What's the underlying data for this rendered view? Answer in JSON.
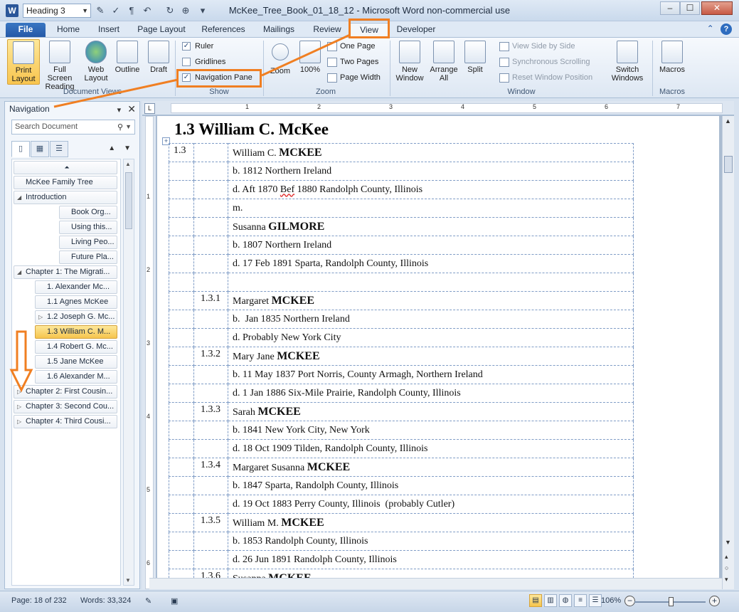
{
  "window": {
    "title": "McKee_Tree_Book_01_18_12 - Microsoft Word non-commercial use",
    "style_box": "Heading 3",
    "word_logo": "W",
    "controls": [
      "–",
      "☐",
      "✕"
    ]
  },
  "ribbon_tabs": [
    "File",
    "Home",
    "Insert",
    "Page Layout",
    "References",
    "Mailings",
    "Review",
    "View",
    "Developer"
  ],
  "ribbon": {
    "document_views": {
      "label": "Document Views",
      "buttons": [
        "Print Layout",
        "Full Screen Reading",
        "Web Layout",
        "Outline",
        "Draft"
      ]
    },
    "show": {
      "label": "Show",
      "ruler": "Ruler",
      "gridlines": "Gridlines",
      "navigation_pane": "Navigation Pane",
      "ruler_checked": true,
      "gridlines_checked": false,
      "navigation_pane_checked": true
    },
    "zoom": {
      "label": "Zoom",
      "zoom": "Zoom",
      "hundred": "100%",
      "one_page": "One Page",
      "two_pages": "Two Pages",
      "page_width": "Page Width"
    },
    "window": {
      "label": "Window",
      "new_window": "New Window",
      "arrange_all": "Arrange All",
      "split": "Split",
      "view_side_by_side": "View Side by Side",
      "synchronous_scrolling": "Synchronous Scrolling",
      "reset_window_position": "Reset Window Position",
      "switch_windows": "Switch Windows"
    },
    "macros": {
      "label": "Macros",
      "button": "Macros"
    }
  },
  "nav": {
    "title": "Navigation",
    "search_placeholder": "Search Document",
    "tree": [
      {
        "label": "",
        "level": 0,
        "expander": "collapse-all"
      },
      {
        "label": "McKee Family Tree",
        "level": 0
      },
      {
        "label": "Introduction",
        "level": 0,
        "expander": "expanded"
      },
      {
        "label": "Book Org...",
        "level": 2
      },
      {
        "label": "Using this...",
        "level": 2
      },
      {
        "label": "Living Peo...",
        "level": 2
      },
      {
        "label": "Future Pla...",
        "level": 2
      },
      {
        "label": "Chapter 1: The Migrati...",
        "level": 0,
        "expander": "expanded"
      },
      {
        "label": "1. Alexander Mc...",
        "level": 1
      },
      {
        "label": "1.1 Agnes McKee",
        "level": 1
      },
      {
        "label": "1.2 Joseph G. Mc...",
        "level": 1,
        "expander": "collapsed"
      },
      {
        "label": "1.3 William C. M...",
        "level": 1,
        "selected": true
      },
      {
        "label": "1.4 Robert G. Mc...",
        "level": 1
      },
      {
        "label": "1.5 Jane McKee",
        "level": 1
      },
      {
        "label": "1.6 Alexander M...",
        "level": 1
      },
      {
        "label": "Chapter 2: First Cousin...",
        "level": 0,
        "expander": "collapsed"
      },
      {
        "label": "Chapter 3: Second Cou...",
        "level": 0,
        "expander": "collapsed"
      },
      {
        "label": "Chapter 4: Third Cousi...",
        "level": 0,
        "expander": "collapsed"
      }
    ]
  },
  "ruler_numbers": [
    "1",
    "2",
    "3",
    "4",
    "5",
    "6",
    "7"
  ],
  "vruler_numbers": [
    "1",
    "2",
    "3",
    "4",
    "5",
    "6"
  ],
  "document": {
    "heading": "1.3 William C. McKee",
    "rows": [
      {
        "c1": "1.3",
        "c2": "",
        "given": "William C.",
        "surname": "MCKEE"
      },
      {
        "c1": "",
        "c2": "",
        "text": "b. 1812 Northern Ireland"
      },
      {
        "c1": "",
        "c2": "",
        "text_a": "d. Aft 1870 ",
        "text_squig": "Bef",
        "text_b": " 1880 Randolph County, Illinois"
      },
      {
        "c1": "",
        "c2": "",
        "text": "m."
      },
      {
        "c1": "",
        "c2": "",
        "given": "Susanna",
        "surname": "GILMORE"
      },
      {
        "c1": "",
        "c2": "",
        "text": "b. 1807 Northern Ireland"
      },
      {
        "c1": "",
        "c2": "",
        "text": "d. 17 Feb 1891 Sparta, Randolph County, Illinois"
      },
      {
        "c1": "",
        "c2": "",
        "text": ""
      },
      {
        "c1": "",
        "c2": "1.3.1",
        "given": "Margaret",
        "surname": "MCKEE"
      },
      {
        "c1": "",
        "c2": "",
        "text": "b.  Jan 1835 Northern Ireland"
      },
      {
        "c1": "",
        "c2": "",
        "text": "d. Probably New York City"
      },
      {
        "c1": "",
        "c2": "1.3.2",
        "given": "Mary Jane",
        "surname": "MCKEE"
      },
      {
        "c1": "",
        "c2": "",
        "text": "b. 11 May 1837 Port Norris, County Armagh, Northern Ireland"
      },
      {
        "c1": "",
        "c2": "",
        "text": "d. 1 Jan 1886 Six-Mile Prairie, Randolph County, Illinois"
      },
      {
        "c1": "",
        "c2": "1.3.3",
        "given": "Sarah",
        "surname": "MCKEE"
      },
      {
        "c1": "",
        "c2": "",
        "text": "b. 1841 New York City, New York"
      },
      {
        "c1": "",
        "c2": "",
        "text": "d. 18 Oct 1909 Tilden, Randolph County, Illinois"
      },
      {
        "c1": "",
        "c2": "1.3.4",
        "given": "Margaret Susanna",
        "surname": "MCKEE"
      },
      {
        "c1": "",
        "c2": "",
        "text": "b. 1847 Sparta, Randolph County, Illinois"
      },
      {
        "c1": "",
        "c2": "",
        "text": "d. 19 Oct 1883 Perry County, Illinois  (probably Cutler)"
      },
      {
        "c1": "",
        "c2": "1.3.5",
        "given": "William M.",
        "surname": "MCKEE"
      },
      {
        "c1": "",
        "c2": "",
        "text": "b. 1853 Randolph County, Illinois"
      },
      {
        "c1": "",
        "c2": "",
        "text": "d. 26 Jun 1891 Randolph County, Illinois"
      },
      {
        "c1": "",
        "c2": "1.3.6",
        "given": "Susanna",
        "surname": "MCKEE"
      }
    ]
  },
  "status": {
    "page": "Page: 18 of 232",
    "words": "Words: 33,324",
    "zoom": "106%",
    "zoom_level": 106
  },
  "colors": {
    "annotation": "#f07f22",
    "file_tab": "#2559a8",
    "selection": "#f6c54d"
  }
}
